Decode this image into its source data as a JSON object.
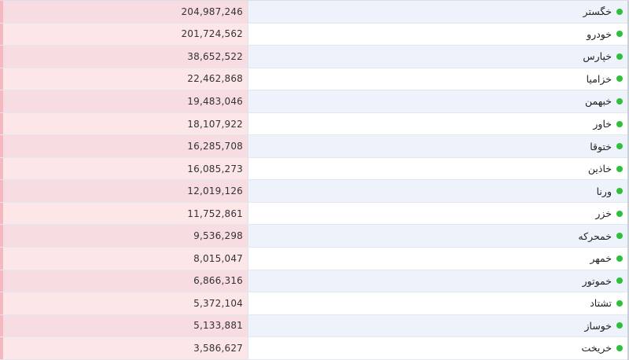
{
  "colors": {
    "status_dot": "#2fbf3a",
    "value_bg_odd": "#f7dde1",
    "value_bg_even": "#fde6e8",
    "name_bg_odd": "#edf2fb",
    "name_bg_even": "#ffffff"
  },
  "rows": [
    {
      "name": "خگستر",
      "value": "204,987,246"
    },
    {
      "name": "خودرو",
      "value": "201,724,562"
    },
    {
      "name": "خپارس",
      "value": "38,652,522"
    },
    {
      "name": "خزامیا",
      "value": "22,462,868"
    },
    {
      "name": "خبهمن",
      "value": "19,483,046"
    },
    {
      "name": "خاور",
      "value": "18,107,922"
    },
    {
      "name": "ختوقا",
      "value": "16,285,708"
    },
    {
      "name": "خاذین",
      "value": "16,085,273"
    },
    {
      "name": "ورنا",
      "value": "12,019,126"
    },
    {
      "name": "خزر",
      "value": "11,752,861"
    },
    {
      "name": "خمحرکه",
      "value": "9,536,298"
    },
    {
      "name": "خمهر",
      "value": "8,015,047"
    },
    {
      "name": "خموتور",
      "value": "6,866,316"
    },
    {
      "name": "تشتاد",
      "value": "5,372,104"
    },
    {
      "name": "خوساز",
      "value": "5,133,881"
    },
    {
      "name": "خریخت",
      "value": "3,586,627"
    }
  ]
}
